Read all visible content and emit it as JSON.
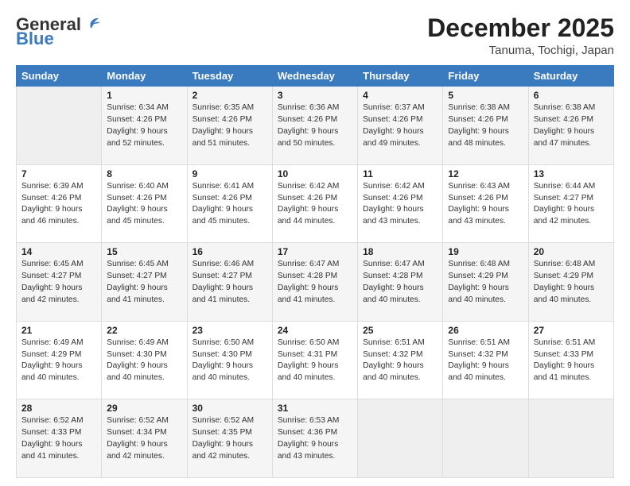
{
  "header": {
    "logo_general": "General",
    "logo_blue": "Blue",
    "month": "December 2025",
    "location": "Tanuma, Tochigi, Japan"
  },
  "weekdays": [
    "Sunday",
    "Monday",
    "Tuesday",
    "Wednesday",
    "Thursday",
    "Friday",
    "Saturday"
  ],
  "weeks": [
    [
      {
        "day": "",
        "info": ""
      },
      {
        "day": "1",
        "info": "Sunrise: 6:34 AM\nSunset: 4:26 PM\nDaylight: 9 hours\nand 52 minutes."
      },
      {
        "day": "2",
        "info": "Sunrise: 6:35 AM\nSunset: 4:26 PM\nDaylight: 9 hours\nand 51 minutes."
      },
      {
        "day": "3",
        "info": "Sunrise: 6:36 AM\nSunset: 4:26 PM\nDaylight: 9 hours\nand 50 minutes."
      },
      {
        "day": "4",
        "info": "Sunrise: 6:37 AM\nSunset: 4:26 PM\nDaylight: 9 hours\nand 49 minutes."
      },
      {
        "day": "5",
        "info": "Sunrise: 6:38 AM\nSunset: 4:26 PM\nDaylight: 9 hours\nand 48 minutes."
      },
      {
        "day": "6",
        "info": "Sunrise: 6:38 AM\nSunset: 4:26 PM\nDaylight: 9 hours\nand 47 minutes."
      }
    ],
    [
      {
        "day": "7",
        "info": "Sunrise: 6:39 AM\nSunset: 4:26 PM\nDaylight: 9 hours\nand 46 minutes."
      },
      {
        "day": "8",
        "info": "Sunrise: 6:40 AM\nSunset: 4:26 PM\nDaylight: 9 hours\nand 45 minutes."
      },
      {
        "day": "9",
        "info": "Sunrise: 6:41 AM\nSunset: 4:26 PM\nDaylight: 9 hours\nand 45 minutes."
      },
      {
        "day": "10",
        "info": "Sunrise: 6:42 AM\nSunset: 4:26 PM\nDaylight: 9 hours\nand 44 minutes."
      },
      {
        "day": "11",
        "info": "Sunrise: 6:42 AM\nSunset: 4:26 PM\nDaylight: 9 hours\nand 43 minutes."
      },
      {
        "day": "12",
        "info": "Sunrise: 6:43 AM\nSunset: 4:26 PM\nDaylight: 9 hours\nand 43 minutes."
      },
      {
        "day": "13",
        "info": "Sunrise: 6:44 AM\nSunset: 4:27 PM\nDaylight: 9 hours\nand 42 minutes."
      }
    ],
    [
      {
        "day": "14",
        "info": "Sunrise: 6:45 AM\nSunset: 4:27 PM\nDaylight: 9 hours\nand 42 minutes."
      },
      {
        "day": "15",
        "info": "Sunrise: 6:45 AM\nSunset: 4:27 PM\nDaylight: 9 hours\nand 41 minutes."
      },
      {
        "day": "16",
        "info": "Sunrise: 6:46 AM\nSunset: 4:27 PM\nDaylight: 9 hours\nand 41 minutes."
      },
      {
        "day": "17",
        "info": "Sunrise: 6:47 AM\nSunset: 4:28 PM\nDaylight: 9 hours\nand 41 minutes."
      },
      {
        "day": "18",
        "info": "Sunrise: 6:47 AM\nSunset: 4:28 PM\nDaylight: 9 hours\nand 40 minutes."
      },
      {
        "day": "19",
        "info": "Sunrise: 6:48 AM\nSunset: 4:29 PM\nDaylight: 9 hours\nand 40 minutes."
      },
      {
        "day": "20",
        "info": "Sunrise: 6:48 AM\nSunset: 4:29 PM\nDaylight: 9 hours\nand 40 minutes."
      }
    ],
    [
      {
        "day": "21",
        "info": "Sunrise: 6:49 AM\nSunset: 4:29 PM\nDaylight: 9 hours\nand 40 minutes."
      },
      {
        "day": "22",
        "info": "Sunrise: 6:49 AM\nSunset: 4:30 PM\nDaylight: 9 hours\nand 40 minutes."
      },
      {
        "day": "23",
        "info": "Sunrise: 6:50 AM\nSunset: 4:30 PM\nDaylight: 9 hours\nand 40 minutes."
      },
      {
        "day": "24",
        "info": "Sunrise: 6:50 AM\nSunset: 4:31 PM\nDaylight: 9 hours\nand 40 minutes."
      },
      {
        "day": "25",
        "info": "Sunrise: 6:51 AM\nSunset: 4:32 PM\nDaylight: 9 hours\nand 40 minutes."
      },
      {
        "day": "26",
        "info": "Sunrise: 6:51 AM\nSunset: 4:32 PM\nDaylight: 9 hours\nand 40 minutes."
      },
      {
        "day": "27",
        "info": "Sunrise: 6:51 AM\nSunset: 4:33 PM\nDaylight: 9 hours\nand 41 minutes."
      }
    ],
    [
      {
        "day": "28",
        "info": "Sunrise: 6:52 AM\nSunset: 4:33 PM\nDaylight: 9 hours\nand 41 minutes."
      },
      {
        "day": "29",
        "info": "Sunrise: 6:52 AM\nSunset: 4:34 PM\nDaylight: 9 hours\nand 42 minutes."
      },
      {
        "day": "30",
        "info": "Sunrise: 6:52 AM\nSunset: 4:35 PM\nDaylight: 9 hours\nand 42 minutes."
      },
      {
        "day": "31",
        "info": "Sunrise: 6:53 AM\nSunset: 4:36 PM\nDaylight: 9 hours\nand 43 minutes."
      },
      {
        "day": "",
        "info": ""
      },
      {
        "day": "",
        "info": ""
      },
      {
        "day": "",
        "info": ""
      }
    ]
  ]
}
